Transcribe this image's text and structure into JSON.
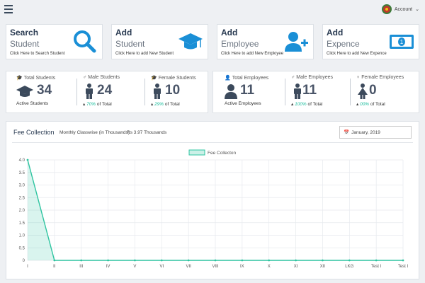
{
  "topbar": {
    "menu_icon": "hamburger-icon",
    "account_label": "Account",
    "account_caret": "⌄"
  },
  "quick_cards": [
    {
      "title": "Search",
      "subtitle": "Student",
      "desc": "Click Here to Search Student",
      "icon": "search-icon",
      "color": "#1a8fd6"
    },
    {
      "title": "Add",
      "subtitle": "Student",
      "desc": "Click Here to add New Student",
      "icon": "graduation-cap-icon",
      "color": "#1a8fd6"
    },
    {
      "title": "Add",
      "subtitle": "Employee",
      "desc": "Click Here to add New Employee",
      "icon": "add-user-icon",
      "color": "#1a8fd6"
    },
    {
      "title": "Add",
      "subtitle": "Expence",
      "desc": "Click Here to add New Expence",
      "icon": "money-bill-icon",
      "color": "#1a8fd6"
    }
  ],
  "student_stats": [
    {
      "label": "Total Students",
      "value": "34",
      "sub": "Active Students",
      "pct": "",
      "sub_suffix": ""
    },
    {
      "label": "Male Students",
      "value": "24",
      "sub": "",
      "pct": "70%",
      "sub_suffix": "of Total"
    },
    {
      "label": "Female Students",
      "value": "10",
      "sub": "",
      "pct": "29%",
      "sub_suffix": "of Total"
    }
  ],
  "employee_stats": [
    {
      "label": "Total Employees",
      "value": "11",
      "sub": "Active Employees",
      "pct": "",
      "sub_suffix": ""
    },
    {
      "label": "Male Employees",
      "value": "11",
      "sub": "",
      "pct": "100%",
      "sub_suffix": "of Total"
    },
    {
      "label": "Female Employees",
      "value": "0",
      "sub": "",
      "pct": "00%",
      "sub_suffix": "of Total"
    }
  ],
  "fee_panel": {
    "title": "Fee Collection",
    "subtitle": "Monthly Classwise (in Thousands)",
    "summary": "Rs 3.97 Thousands",
    "date_value": "January, 2019"
  },
  "colors": {
    "accent": "#1a8fd6",
    "teal": "#2ec4a0",
    "navy": "#2a3b52"
  },
  "chart_data": {
    "type": "area",
    "legend": "Fee Collecton",
    "categories": [
      "I",
      "II",
      "III",
      "IV",
      "V",
      "VI",
      "VII",
      "VIII",
      "IX",
      "X",
      "XI",
      "XII",
      "LKG",
      "Test I",
      "Test I"
    ],
    "values": [
      4.0,
      0,
      0,
      0,
      0,
      0,
      0,
      0,
      0,
      0,
      0,
      0,
      0,
      0,
      0
    ],
    "ylim": [
      0,
      4.0
    ],
    "yticks": [
      "4.0",
      "3.5",
      "3.0",
      "2.5",
      "2.0",
      "1.5",
      "1.0",
      "0.5",
      "0"
    ],
    "grid": true,
    "legend_position": "top-center"
  }
}
